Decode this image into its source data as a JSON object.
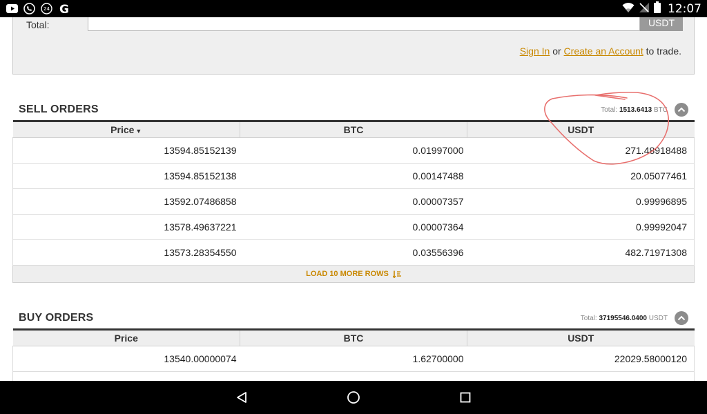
{
  "status_bar": {
    "time": "12:07",
    "left_icons": [
      "youtube-icon",
      "viber-icon",
      "clock-24-icon",
      "google-icon"
    ],
    "right_icons": [
      "wifi-icon",
      "no-signal-icon",
      "battery-icon"
    ]
  },
  "trade_form": {
    "total_label": "Total:",
    "total_value": "",
    "unit": "USDT",
    "signin_label": "Sign In",
    "or_text": " or ",
    "create_account_label": "Create an Account",
    "trade_suffix": " to trade."
  },
  "sell_orders": {
    "title": "SELL ORDERS",
    "total_label": "Total:",
    "total_value": "1513.6413",
    "total_unit": "BTC",
    "columns": [
      "Price",
      "BTC",
      "USDT"
    ],
    "rows": [
      [
        "13594.85152139",
        "0.01997000",
        "271.48918488"
      ],
      [
        "13594.85152138",
        "0.00147488",
        "20.05077461"
      ],
      [
        "13592.07486858",
        "0.00007357",
        "0.99996895"
      ],
      [
        "13578.49637221",
        "0.00007364",
        "0.99992047"
      ],
      [
        "13573.28354550",
        "0.03556396",
        "482.71971308"
      ]
    ],
    "load_more_label": "LOAD 10 MORE ROWS"
  },
  "buy_orders": {
    "title": "BUY ORDERS",
    "total_label": "Total:",
    "total_value": "37195546.0400",
    "total_unit": "USDT",
    "columns": [
      "Price",
      "BTC",
      "USDT"
    ],
    "rows": [
      [
        "13540.00000074",
        "1.62700000",
        "22029.58000120"
      ]
    ]
  },
  "colors": {
    "accent": "#c98800",
    "annotation": "#e8706e",
    "header_bg": "#eeeeee"
  }
}
